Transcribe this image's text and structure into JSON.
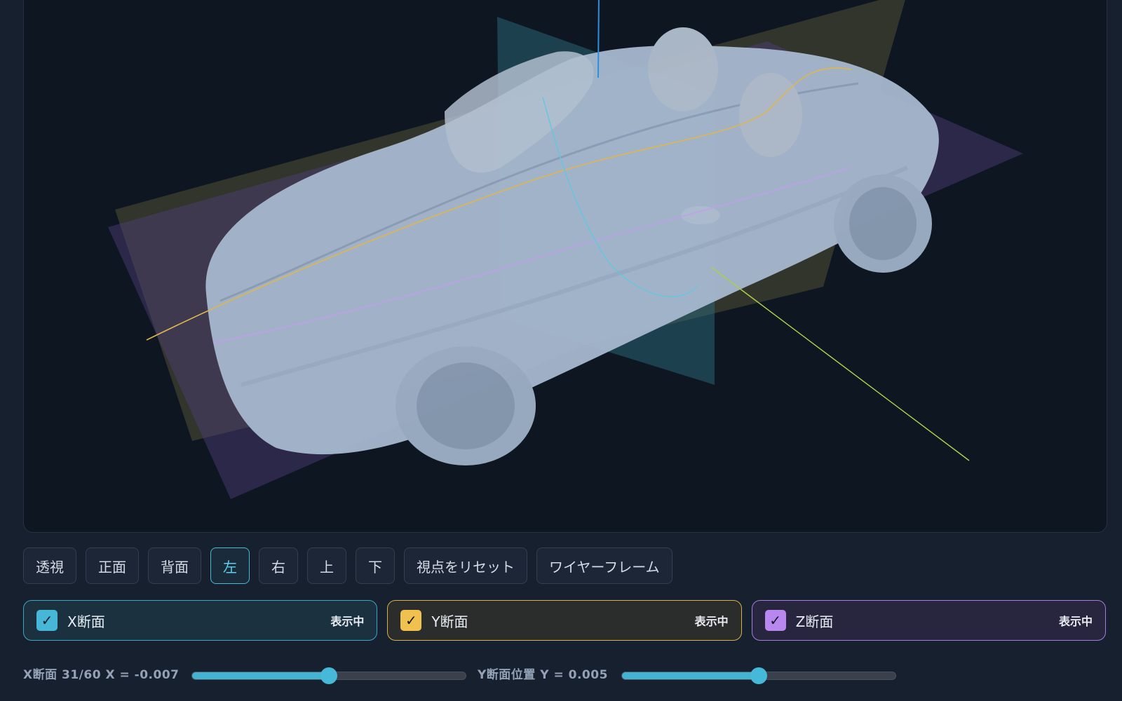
{
  "view_buttons": [
    {
      "label": "透視",
      "active": false
    },
    {
      "label": "正面",
      "active": false
    },
    {
      "label": "背面",
      "active": false
    },
    {
      "label": "左",
      "active": true
    },
    {
      "label": "右",
      "active": false
    },
    {
      "label": "上",
      "active": false
    },
    {
      "label": "下",
      "active": false
    },
    {
      "label": "視点をリセット",
      "active": false
    },
    {
      "label": "ワイヤーフレーム",
      "active": false
    }
  ],
  "sections": [
    {
      "id": "x",
      "label": "X断面",
      "status": "表示中",
      "checked": true
    },
    {
      "id": "y",
      "label": "Y断面",
      "status": "表示中",
      "checked": true
    },
    {
      "id": "z",
      "label": "Z断面",
      "status": "表示中",
      "checked": true
    }
  ],
  "sliders": {
    "x": {
      "label": "X断面 31/60 X = -0.007",
      "fraction": 0.5
    },
    "y": {
      "label": "Y断面位置 Y = 0.005",
      "fraction": 0.5
    }
  },
  "colors": {
    "accent": "#46b7d6",
    "x_section": "#46b7d6",
    "y_section": "#f1c14f",
    "z_section": "#b887f0"
  }
}
